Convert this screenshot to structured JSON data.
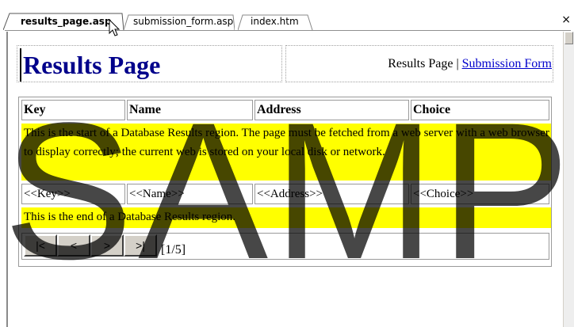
{
  "tabs": [
    {
      "label": "results_page.asp",
      "active": true
    },
    {
      "label": "submission_form.asp",
      "active": false
    },
    {
      "label": "index.htm",
      "active": false
    }
  ],
  "close_label": "×",
  "page": {
    "title": "Results Page",
    "nav_current": "Results Page",
    "nav_separator": " | ",
    "nav_link": "Submission Form"
  },
  "table": {
    "headers": [
      "Key",
      "Name",
      "Address",
      "Choice"
    ],
    "start_notice": "This is the start of a Database Results region. The page must be fetched from a web server with a web browser to display correctly; the current web is stored on your local disk or network.",
    "placeholders": [
      "<<Key>>",
      "<<Name>>",
      "<<Address>>",
      "<<Choice>>"
    ],
    "end_notice": "This is the end of a Database Results region."
  },
  "pager": {
    "first_label": "|<",
    "prev_label": "<",
    "next_label": ">",
    "last_label": ">|",
    "page_info": "[1/5]"
  },
  "watermark": "SAMPLE",
  "colors": {
    "title": "#00008b",
    "link": "#0000cc",
    "highlight": "#ffff00"
  }
}
